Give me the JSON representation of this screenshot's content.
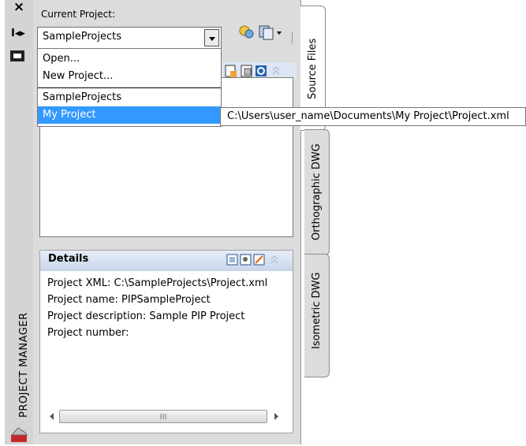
{
  "palette": {
    "title_bar_bg": "#d4d4d4",
    "panel_bg": "#dcdcdc",
    "selection": "#3399ff",
    "header_gradient_top": "#e6edf7",
    "header_gradient_bottom": "#c8d6ea"
  },
  "title_bar": {
    "title": "PROJECT MANAGER",
    "icons": [
      "close-icon",
      "auto-hide-icon",
      "properties-icon",
      "app-logo-icon"
    ]
  },
  "project_selector": {
    "label": "Current Project:",
    "selected": "SampleProjects",
    "dropdown_items": [
      {
        "label": "Open...",
        "selected": false
      },
      {
        "label": "New Project...",
        "selected": false
      },
      {
        "label": "SampleProjects",
        "selected": false
      },
      {
        "label": "My Project",
        "selected": true
      }
    ],
    "toolbar_icons": [
      "project-setup-icon",
      "publish-icon"
    ]
  },
  "tooltip": {
    "text": "C:\\Users\\user_name\\Documents\\My Project\\Project.xml"
  },
  "source_files": {
    "toolbar_icons": [
      "new-drawing-icon",
      "copy-drawing-icon",
      "refresh-icon",
      "collapse-icon"
    ]
  },
  "details": {
    "title": "Details",
    "lines": [
      "Project XML: C:\\SampleProjects\\Project.xml",
      "Project name: PIPSampleProject",
      "Project description: Sample PIP Project",
      "Project number:"
    ],
    "toolbar_icons": [
      "details-view-icon",
      "preview-icon",
      "select-icon",
      "collapse-icon"
    ]
  },
  "tabs": [
    {
      "label": "Source Files",
      "active": true
    },
    {
      "label": "Orthographic DWG",
      "active": false
    },
    {
      "label": "Isometric DWG",
      "active": false
    }
  ]
}
